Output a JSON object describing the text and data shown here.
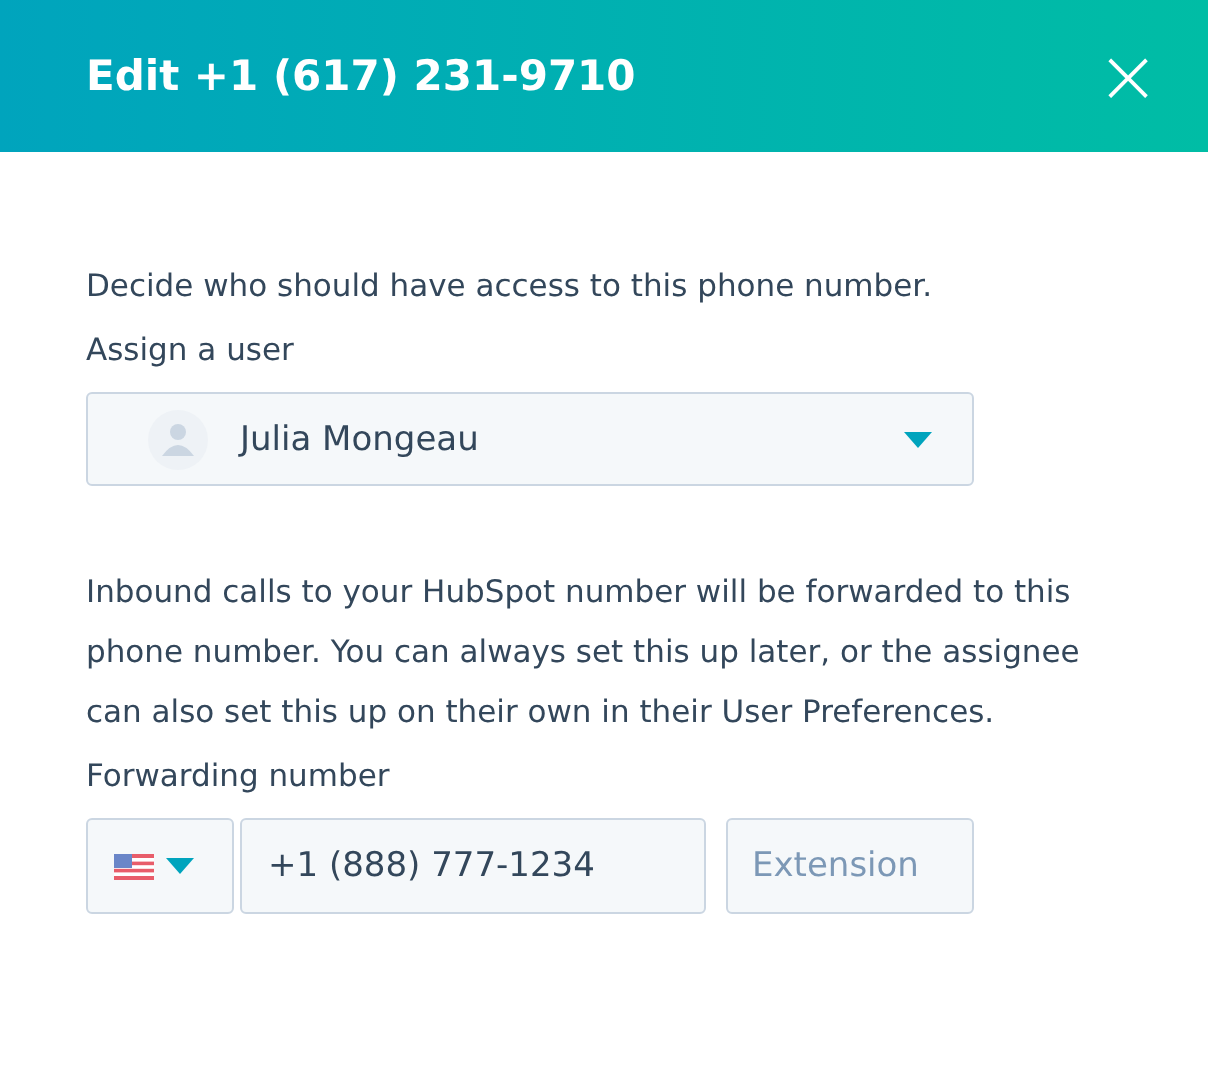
{
  "dialog": {
    "title": "Edit +1 (617) 231-9710",
    "close": "×"
  },
  "intro": "Decide who should have access to this phone number.",
  "assign": {
    "label": "Assign a user",
    "value": "Julia Mongeau"
  },
  "note": "Inbound calls to your HubSpot number will be forwarded to this phone number. You can always set this up later, or the assignee can also set this up on their own in their User Preferences.",
  "forwarding": {
    "label": "Forwarding number",
    "value": "+1 (888) 777-1234",
    "extension_placeholder": "Extension"
  }
}
